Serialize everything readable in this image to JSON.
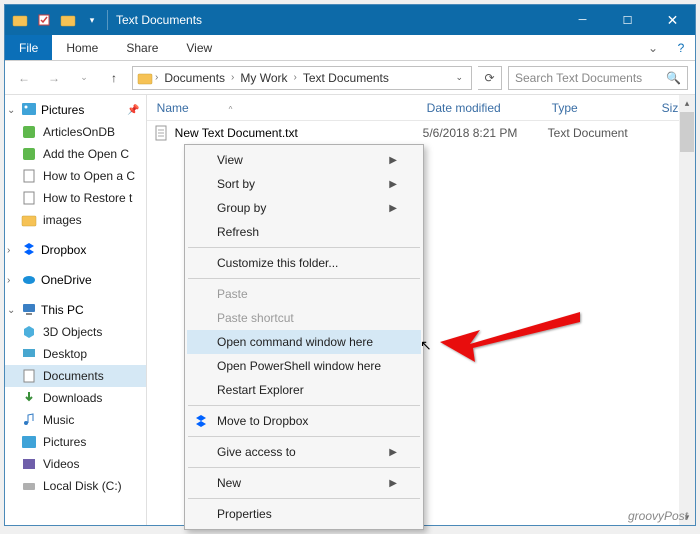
{
  "window": {
    "title": "Text Documents"
  },
  "ribbon": {
    "file": "File",
    "home": "Home",
    "share": "Share",
    "view": "View"
  },
  "address": {
    "crumbs": [
      "Documents",
      "My Work",
      "Text Documents"
    ],
    "search_placeholder": "Search Text Documents"
  },
  "columns": {
    "name": "Name",
    "date": "Date modified",
    "type": "Type",
    "size": "Size"
  },
  "file": {
    "name": "New Text Document.txt",
    "date": "5/6/2018 8:21 PM",
    "type": "Text Document"
  },
  "nav": {
    "pictures": "Pictures",
    "items1": [
      "ArticlesOnDB",
      "Add the Open C",
      "How to Open a C",
      "How to Restore t",
      "images"
    ],
    "dropbox": "Dropbox",
    "onedrive": "OneDrive",
    "thispc": "This PC",
    "pcitems": [
      "3D Objects",
      "Desktop",
      "Documents",
      "Downloads",
      "Music",
      "Pictures",
      "Videos",
      "Local Disk (C:)"
    ]
  },
  "ctx": {
    "view": "View",
    "sortby": "Sort by",
    "groupby": "Group by",
    "refresh": "Refresh",
    "customize": "Customize this folder...",
    "paste": "Paste",
    "pasteshortcut": "Paste shortcut",
    "opencmd": "Open command window here",
    "openps": "Open PowerShell window here",
    "restart": "Restart Explorer",
    "movedropbox": "Move to Dropbox",
    "giveaccess": "Give access to",
    "new": "New",
    "properties": "Properties"
  },
  "watermark": "groovyPost"
}
